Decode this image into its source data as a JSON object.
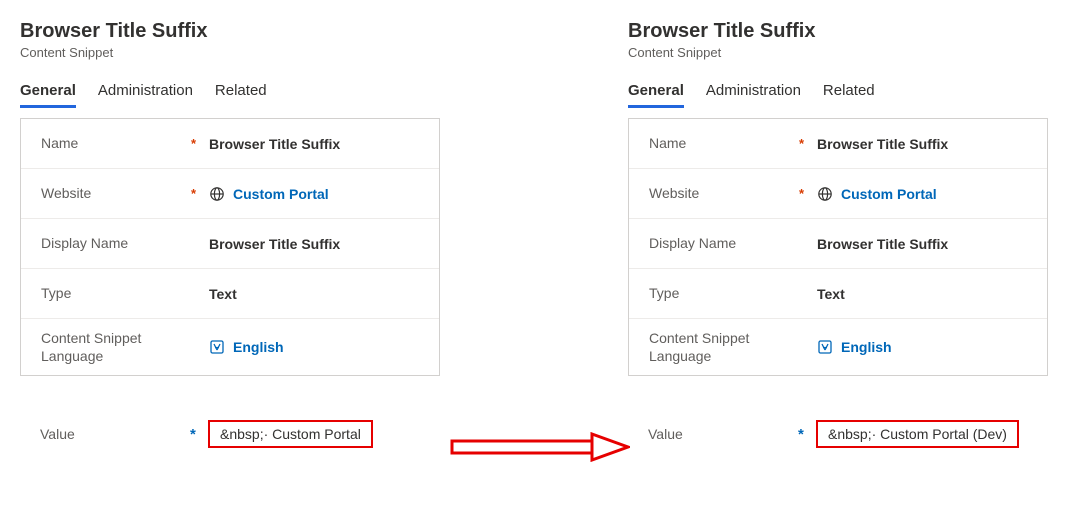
{
  "left": {
    "title": "Browser Title Suffix",
    "subtitle": "Content Snippet",
    "tabs": {
      "general": "General",
      "administration": "Administration",
      "related": "Related"
    },
    "rows": {
      "name_label": "Name",
      "name_value": "Browser Title Suffix",
      "website_label": "Website",
      "website_value": "Custom Portal",
      "display_name_label": "Display Name",
      "display_name_value": "Browser Title Suffix",
      "type_label": "Type",
      "type_value": "Text",
      "lang_label": "Content Snippet Language",
      "lang_value": "English"
    },
    "value_label": "Value",
    "value_value": "&nbsp;· Custom Portal"
  },
  "right": {
    "title": "Browser Title Suffix",
    "subtitle": "Content Snippet",
    "tabs": {
      "general": "General",
      "administration": "Administration",
      "related": "Related"
    },
    "rows": {
      "name_label": "Name",
      "name_value": "Browser Title Suffix",
      "website_label": "Website",
      "website_value": "Custom Portal",
      "display_name_label": "Display Name",
      "display_name_value": "Browser Title Suffix",
      "type_label": "Type",
      "type_value": "Text",
      "lang_label": "Content Snippet Language",
      "lang_value": "English"
    },
    "value_label": "Value",
    "value_value": "&nbsp;· Custom Portal (Dev)"
  },
  "required_mark": "*"
}
